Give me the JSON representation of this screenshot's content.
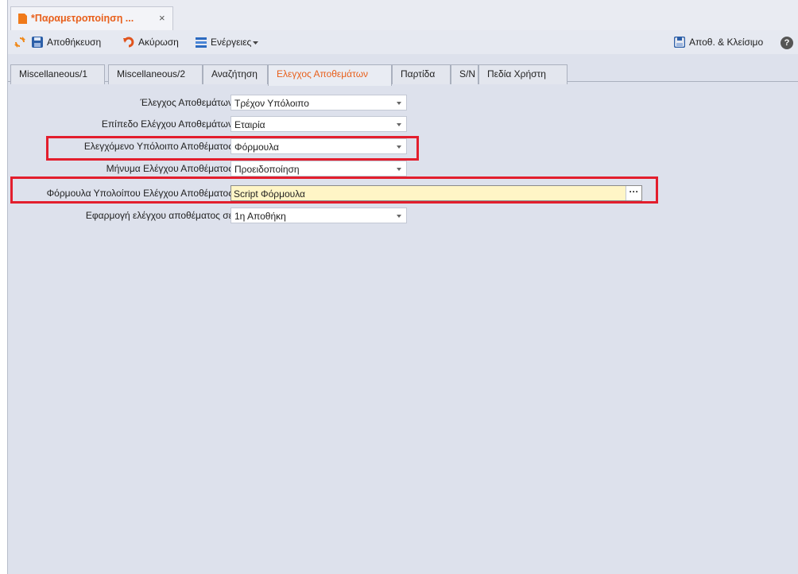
{
  "document_tab": {
    "title": "*Παραμετροποίηση ...",
    "close": "×"
  },
  "toolbar": {
    "refresh_icon": "refresh-icon",
    "save_label": "Αποθήκευση",
    "cancel_label": "Ακύρωση",
    "actions_label": "Ενέργειες",
    "save_close_label": "Αποθ. & Κλείσιμο",
    "help_label": "?"
  },
  "tabs": [
    {
      "label": "Miscellaneous/1"
    },
    {
      "label": "Miscellaneous/2"
    },
    {
      "label": "Αναζήτηση"
    },
    {
      "label": "Ελεγχος Αποθεμάτων",
      "active": true
    },
    {
      "label": "Παρτίδα"
    },
    {
      "label": "S/N"
    },
    {
      "label": "Πεδία Χρήστη"
    }
  ],
  "form": {
    "fields": [
      {
        "label": "Έλεγχος Αποθεμάτων",
        "value": "Τρέχον Υπόλοιπο"
      },
      {
        "label": "Επίπεδο Ελέγχου Αποθεμάτων",
        "value": "Εταιρία"
      },
      {
        "label": "Ελεγχόμενο Υπόλοιπο Αποθέματος",
        "value": "Φόρμουλα"
      },
      {
        "label": "Μήνυμα Ελέγχου Αποθέματος",
        "value": "Προειδοποίηση"
      },
      {
        "label": "Φόρμουλα Υπολοίπου Ελέγχου Αποθέματος",
        "value": "Script Φόρμουλα",
        "button": "···"
      },
      {
        "label": "Εφαρμογή ελέγχου αποθέματος σε",
        "value": "1η Αποθήκη"
      }
    ]
  },
  "colors": {
    "accent": "#e8601c",
    "highlight_box": "#e31e2d",
    "formula_field_bg": "#fff5c6"
  }
}
